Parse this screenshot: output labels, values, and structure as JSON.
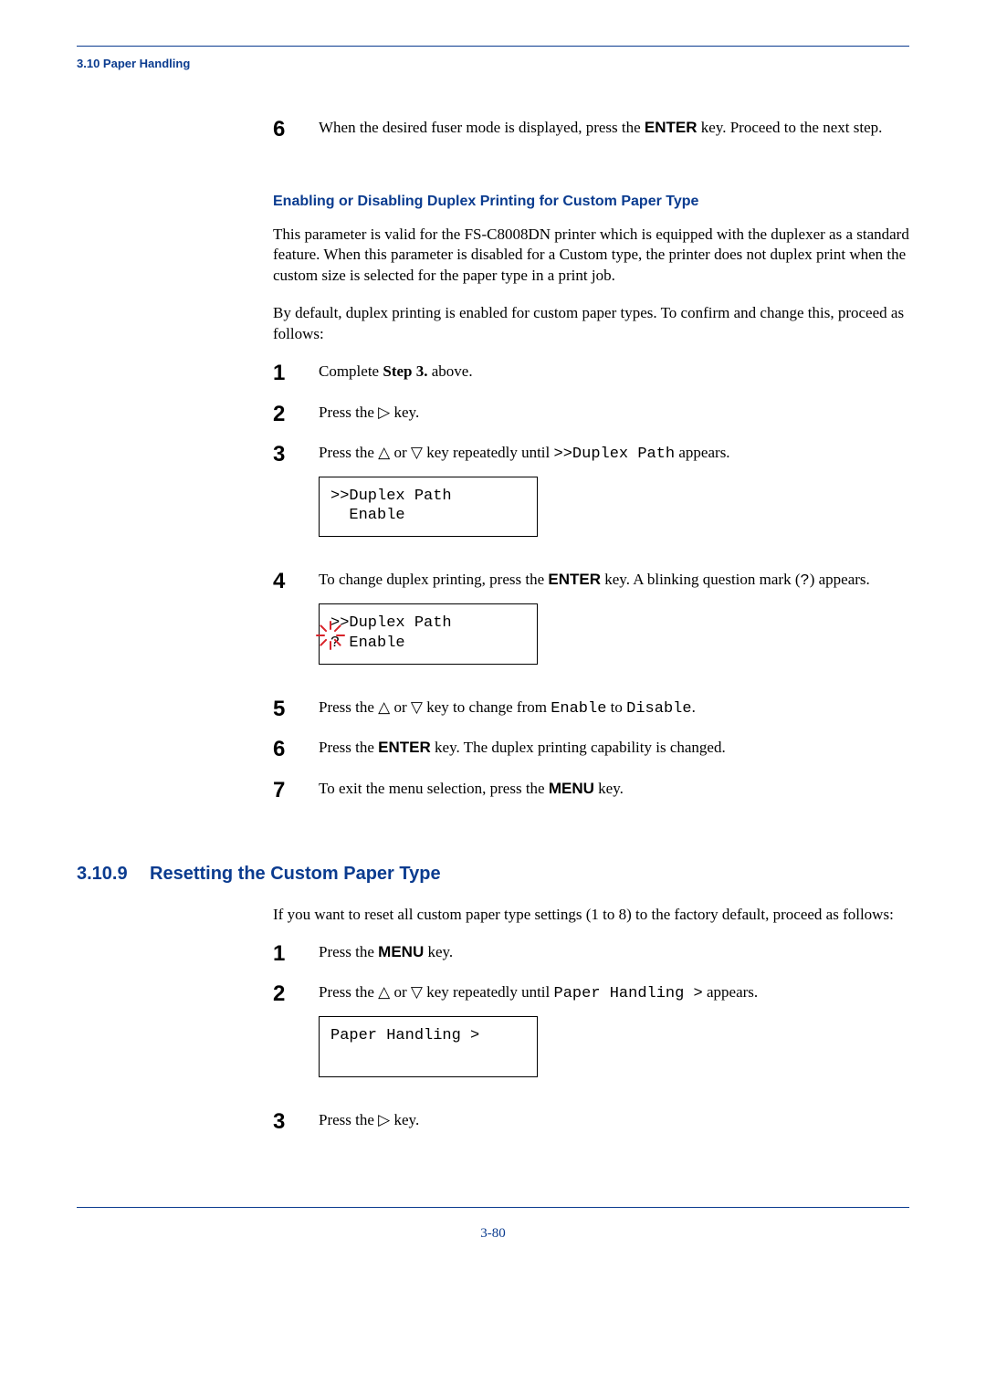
{
  "running_head": "3.10 Paper Handling",
  "colors": {
    "accent": "#0a3b8f",
    "marker": "#d8232a"
  },
  "block1": {
    "step6": {
      "num": "6",
      "pre": "When the desired fuser mode is displayed, press the ",
      "key": "ENTER",
      "post": " key. Proceed to the next step."
    }
  },
  "subhead1": "Enabling or Disabling Duplex Printing for Custom Paper Type",
  "para1": "This parameter is valid for the FS-C8008DN printer which is equipped with the duplexer as a standard feature. When this parameter is disabled for a Custom type, the printer does not duplex print when the custom size is selected for the paper type in a print job.",
  "para2": "By default, duplex printing is enabled for custom paper types. To confirm and change this, proceed as follows:",
  "steps_a": {
    "s1": {
      "num": "1",
      "pre": "Complete ",
      "bold": "Step 3.",
      "post": " above."
    },
    "s2": {
      "num": "2",
      "pre": "Press the ",
      "tri": "▷",
      "post": " key."
    },
    "s3": {
      "num": "3",
      "pre": "Press the ",
      "tri_up": "△",
      "mid": " or ",
      "tri_dn": "▽",
      "post1": " key repeatedly until ",
      "mono": ">>Duplex Path",
      "post2": " appears.",
      "disp_l1": ">>Duplex Path",
      "disp_l2": "  Enable"
    },
    "s4": {
      "num": "4",
      "pre": "To change duplex printing, press the ",
      "key": "ENTER",
      "post1": " key. A blinking question mark (",
      "mono_q": "?",
      "post2": ") appears.",
      "disp_l1": ">>Duplex Path",
      "disp_l2": "? Enable"
    },
    "s5": {
      "num": "5",
      "pre": "Press the ",
      "tri_up": "△",
      "mid": " or ",
      "tri_dn": "▽",
      "post1": " key to change from ",
      "mono1": "Enable",
      "mid2": " to ",
      "mono2": "Disable",
      "post2": "."
    },
    "s6": {
      "num": "6",
      "pre": "Press the ",
      "key": "ENTER",
      "post": " key. The duplex printing capability is changed."
    },
    "s7": {
      "num": "7",
      "pre": "To exit the menu selection, press the ",
      "key": "MENU",
      "post": " key."
    }
  },
  "section": {
    "num": "3.10.9",
    "title": "Resetting the Custom Paper Type"
  },
  "para3": "If you want to reset all custom paper type settings (1 to 8) to the factory default, proceed as follows:",
  "steps_b": {
    "s1": {
      "num": "1",
      "pre": "Press the ",
      "key": "MENU",
      "post": " key."
    },
    "s2": {
      "num": "2",
      "pre": "Press the ",
      "tri_up": "△",
      "mid": " or ",
      "tri_dn": "▽",
      "post1": " key repeatedly until ",
      "mono": "Paper Handling >",
      "post2": " appears.",
      "disp_l1": "Paper Handling >",
      "disp_l2": " "
    },
    "s3": {
      "num": "3",
      "pre": "Press the ",
      "tri": "▷",
      "post": " key."
    }
  },
  "page_num": "3-80"
}
